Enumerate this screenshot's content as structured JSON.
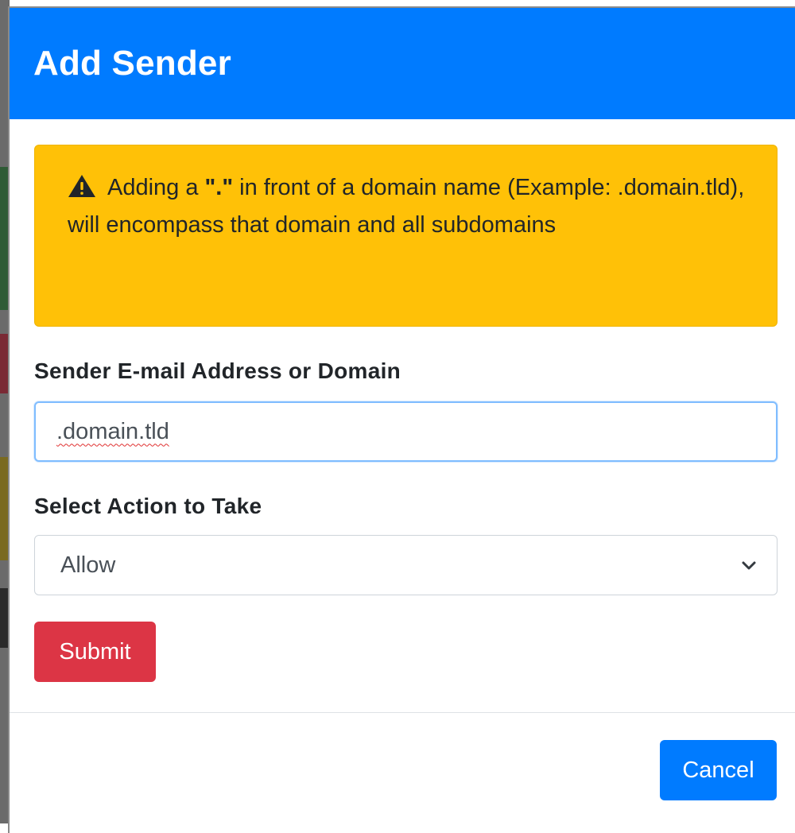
{
  "modal": {
    "title": "Add Sender"
  },
  "alert": {
    "icon": "warning-triangle-icon",
    "text_before": "Adding a ",
    "highlight": "\".\"",
    "text_after": " in front of a domain name (Example: .domain.tld), will encompass that domain and all subdomains",
    "color": "#ffc107"
  },
  "form": {
    "sender_label": "Sender E-mail Address or Domain",
    "sender_value": ".domain.tld",
    "action_label": "Select Action to Take",
    "action_selected": "Allow",
    "submit_label": "Submit"
  },
  "footer": {
    "cancel_label": "Cancel"
  },
  "colors": {
    "header": "#007bff",
    "submit": "#dc3545",
    "cancel": "#007bff",
    "input_focus_border": "#80bdff"
  }
}
